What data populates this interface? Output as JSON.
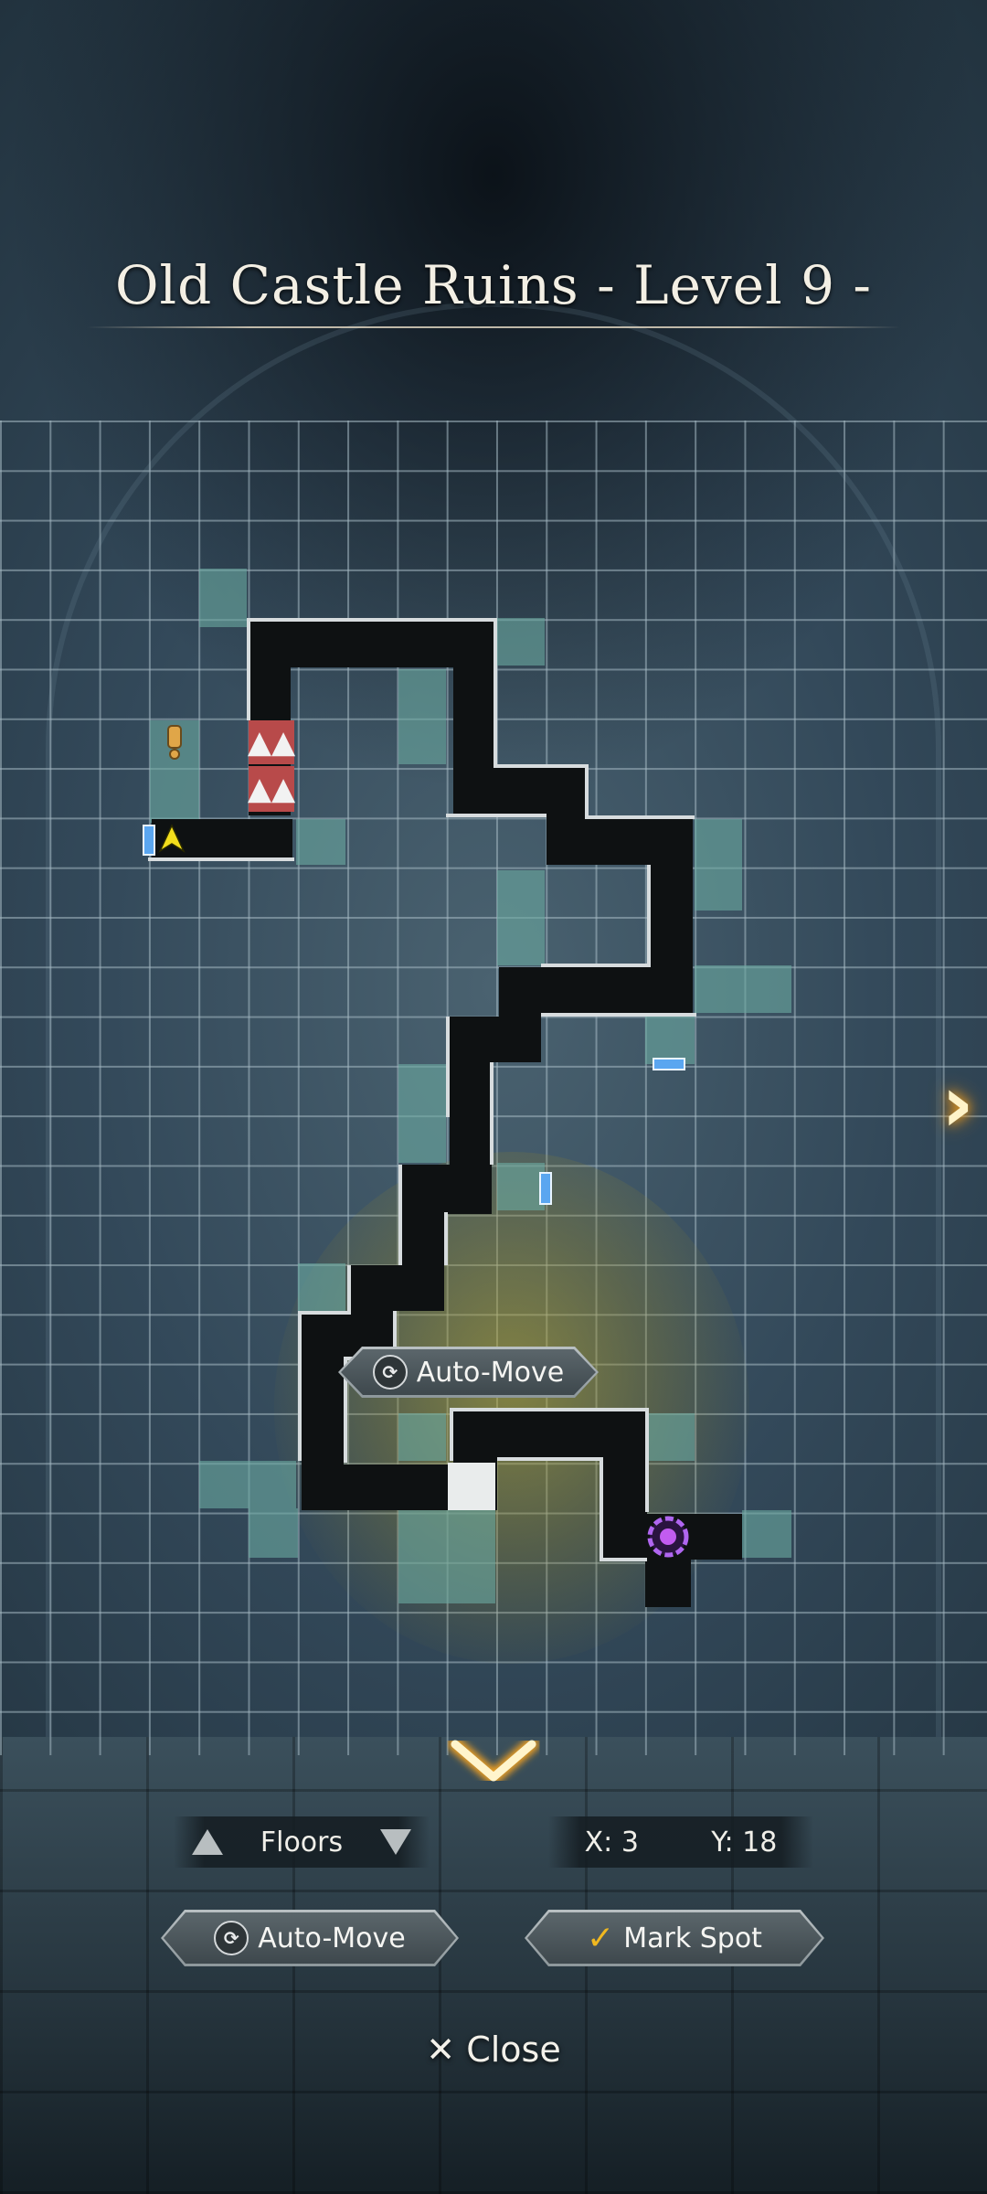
{
  "header": {
    "title": "Old Castle Ruins - Level 9 -"
  },
  "map": {
    "auto_move_tooltip": "Auto-Move",
    "player_icon": "yellow-arrow-icon",
    "event_icon": "exclamation-icon",
    "hazard_icon": "spike-trap-icon",
    "stairs_icon": "purple-orb-icon",
    "door_icon": "blue-door-icon",
    "next_arrow": "chevron-right-icon",
    "down_arrow": "chevron-down-icon",
    "colors": {
      "path": "#0e1112",
      "explored": "#6aa8a0",
      "accent": "#f0a020",
      "trap": "#b84a4a",
      "stairs": "#a24bd6",
      "door": "#5aa6f0"
    }
  },
  "footer": {
    "floors_label": "Floors",
    "x_label": "X: 3",
    "y_label": "Y: 18",
    "auto_move_label": "Auto-Move",
    "mark_spot_label": "Mark Spot",
    "close_label": "Close"
  }
}
